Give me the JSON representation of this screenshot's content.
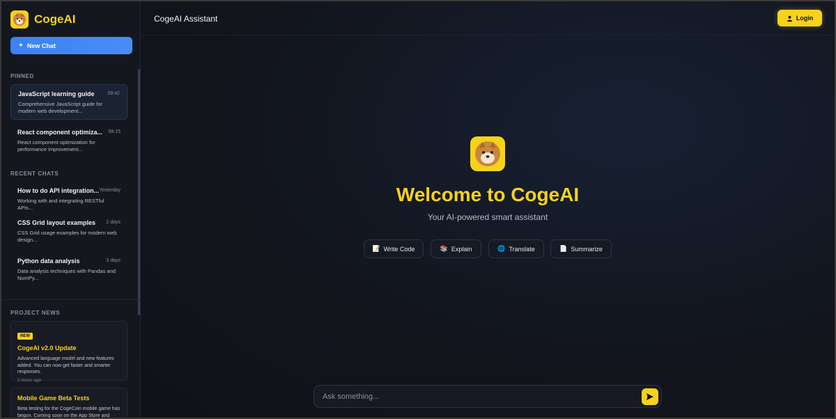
{
  "app": {
    "name": "CogeAI",
    "new_chat_label": "New Chat",
    "accent_color": "#f7d21b",
    "primary_button_color": "#3b82f6"
  },
  "sidebar": {
    "pinned_label": "PINNED",
    "recent_label": "RECENT CHATS",
    "news_label": "PROJECT NEWS",
    "pinned": [
      {
        "title": "JavaScript learning guide",
        "time": "09:42",
        "desc": "Comprehensive JavaScript guide for modern web development..."
      },
      {
        "title": "React component optimiza...",
        "time": "08:15",
        "desc": "React component optimization for performance improvement..."
      }
    ],
    "recent": [
      {
        "title": "How to do API integration...",
        "time": "Yesterday",
        "desc": "Working with and integrating RESTful APIs..."
      },
      {
        "title": "CSS Grid layout examples",
        "time": "2 days",
        "desc": "CSS Grid usage examples for modern web design..."
      },
      {
        "title": "Python data analysis",
        "time": "3 days",
        "desc": "Data analysis techniques with Pandas and NumPy..."
      }
    ],
    "news": [
      {
        "badge": "NEW",
        "title": "CogeAI v2.0 Update",
        "desc": "Advanced language model and new features added. You can now get faster and smarter responses.",
        "time": "2 hours ago"
      },
      {
        "title": "Mobile Game Beta Tests",
        "desc": "Beta testing for the CogeCoin mobile game has begun. Coming soon on the App Store and"
      }
    ]
  },
  "header": {
    "title": "CogeAI Assistant",
    "login_label": "Login"
  },
  "welcome": {
    "heading": "Welcome to CogeAI",
    "tagline": "Your AI-powered smart assistant",
    "actions": [
      {
        "label": "Write Code",
        "icon": "code-icon"
      },
      {
        "label": "Explain",
        "icon": "book-icon"
      },
      {
        "label": "Translate",
        "icon": "globe-icon"
      },
      {
        "label": "Summarize",
        "icon": "document-icon"
      }
    ]
  },
  "composer": {
    "placeholder": "Ask something...",
    "send_icon": "send-icon"
  }
}
